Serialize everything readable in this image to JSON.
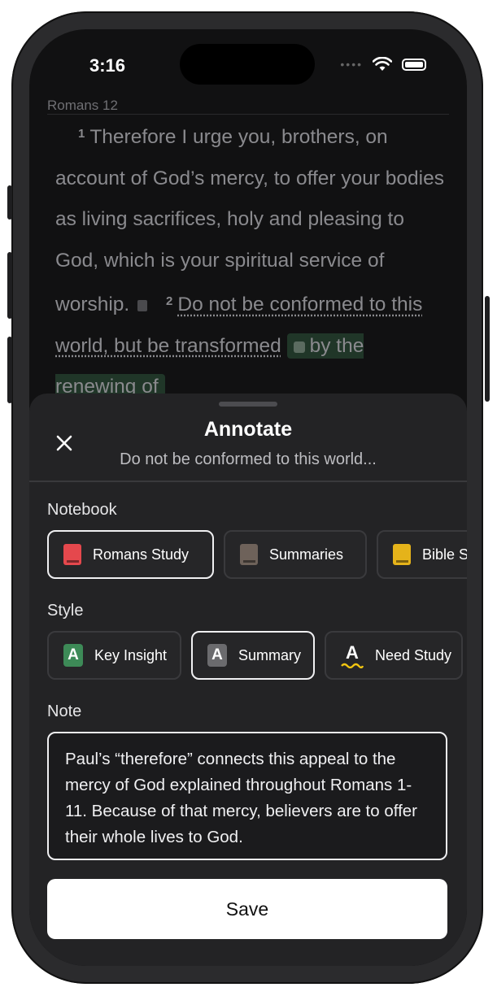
{
  "status_bar": {
    "time": "3:16"
  },
  "reader": {
    "chapter_label": "Romans 12",
    "verse1_number": "1",
    "verse1_text": "Therefore I urge you, brothers, on account of God’s mercy, to offer your bodies as living sacrifices, holy and pleasing to God, which is your spiritual service of worship.",
    "verse2_number": "2",
    "verse2_underlined": "Do not be conformed to this world, but be transformed",
    "verse2_highlighted": "by the renewing of"
  },
  "sheet": {
    "title": "Annotate",
    "subtitle": "Do not be conformed to this world...",
    "notebook_label": "Notebook",
    "notebooks": [
      {
        "label": "Romans Study",
        "color": "#e5484d",
        "selected": true
      },
      {
        "label": "Summaries",
        "color": "#6e625a",
        "selected": false
      },
      {
        "label": "Bible S",
        "color": "#e5b31a",
        "selected": false
      }
    ],
    "style_label": "Style",
    "styles": [
      {
        "label": "Key Insight",
        "badge": "A",
        "color": "#3d8a57",
        "selected": false
      },
      {
        "label": "Summary",
        "badge": "A",
        "color": "#6b6b6e",
        "selected": true
      },
      {
        "label": "Need Study",
        "badge": "A",
        "color": "#f2c511",
        "selected": false
      }
    ],
    "note_label": "Note",
    "note_text": "Paul’s “therefore” connects this appeal to the mercy of God explained throughout Romans 1-11. Because of that mercy, believers are to offer their whole lives to God.",
    "save_label": "Save"
  }
}
